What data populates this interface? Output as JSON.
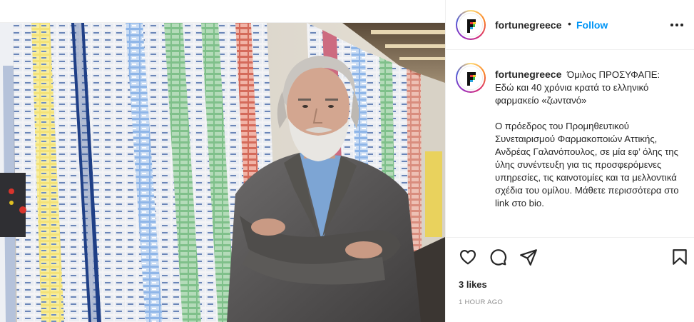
{
  "post": {
    "account": {
      "username": "fortunegreece",
      "follow_label": "Follow",
      "separator": "•",
      "avatar_letter": "F"
    },
    "caption": {
      "username": "fortunegreece",
      "paragraph1": "Όμιλος ΠΡΟΣΥΦΑΠΕ: Εδώ και 40 χρόνια κρατά το ελληνικό φαρμακείο «ζωντανό»",
      "paragraph2": "Ο πρόεδρος του Προμηθευτικού Συνεταιρισμού Φαρμακοποιών Αττικής, Ανδρέας Γαλανόπουλος, σε μία εφ’ όλης της ύλης συνέντευξη για τις προσφερόμενες υπηρεσίες, τις καινοτομίες και τα μελλοντικά σχέδια του ομίλου. Μάθετε περισσότερα στο link στο bio."
    },
    "actions": {
      "icons": [
        "heart-icon",
        "comment-icon",
        "share-icon",
        "bookmark-icon"
      ]
    },
    "likes_label": "3 likes",
    "timestamp": "1 HOUR AGO"
  },
  "colors": {
    "follow": "#0095f6",
    "text": "#262626",
    "muted": "#8e8e8e",
    "border": "#efefef"
  }
}
